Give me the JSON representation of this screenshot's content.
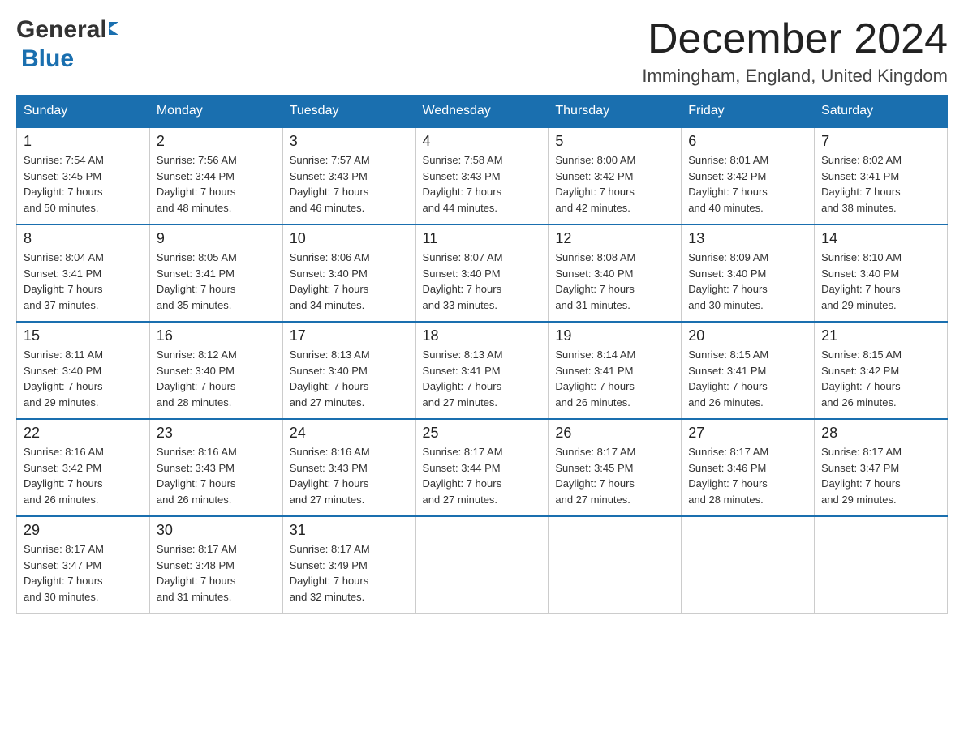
{
  "header": {
    "month_title": "December 2024",
    "location": "Immingham, England, United Kingdom",
    "logo_general": "General",
    "logo_blue": "Blue"
  },
  "days_of_week": [
    "Sunday",
    "Monday",
    "Tuesday",
    "Wednesday",
    "Thursday",
    "Friday",
    "Saturday"
  ],
  "weeks": [
    [
      {
        "day": "1",
        "sunrise": "7:54 AM",
        "sunset": "3:45 PM",
        "daylight": "7 hours and 50 minutes."
      },
      {
        "day": "2",
        "sunrise": "7:56 AM",
        "sunset": "3:44 PM",
        "daylight": "7 hours and 48 minutes."
      },
      {
        "day": "3",
        "sunrise": "7:57 AM",
        "sunset": "3:43 PM",
        "daylight": "7 hours and 46 minutes."
      },
      {
        "day": "4",
        "sunrise": "7:58 AM",
        "sunset": "3:43 PM",
        "daylight": "7 hours and 44 minutes."
      },
      {
        "day": "5",
        "sunrise": "8:00 AM",
        "sunset": "3:42 PM",
        "daylight": "7 hours and 42 minutes."
      },
      {
        "day": "6",
        "sunrise": "8:01 AM",
        "sunset": "3:42 PM",
        "daylight": "7 hours and 40 minutes."
      },
      {
        "day": "7",
        "sunrise": "8:02 AM",
        "sunset": "3:41 PM",
        "daylight": "7 hours and 38 minutes."
      }
    ],
    [
      {
        "day": "8",
        "sunrise": "8:04 AM",
        "sunset": "3:41 PM",
        "daylight": "7 hours and 37 minutes."
      },
      {
        "day": "9",
        "sunrise": "8:05 AM",
        "sunset": "3:41 PM",
        "daylight": "7 hours and 35 minutes."
      },
      {
        "day": "10",
        "sunrise": "8:06 AM",
        "sunset": "3:40 PM",
        "daylight": "7 hours and 34 minutes."
      },
      {
        "day": "11",
        "sunrise": "8:07 AM",
        "sunset": "3:40 PM",
        "daylight": "7 hours and 33 minutes."
      },
      {
        "day": "12",
        "sunrise": "8:08 AM",
        "sunset": "3:40 PM",
        "daylight": "7 hours and 31 minutes."
      },
      {
        "day": "13",
        "sunrise": "8:09 AM",
        "sunset": "3:40 PM",
        "daylight": "7 hours and 30 minutes."
      },
      {
        "day": "14",
        "sunrise": "8:10 AM",
        "sunset": "3:40 PM",
        "daylight": "7 hours and 29 minutes."
      }
    ],
    [
      {
        "day": "15",
        "sunrise": "8:11 AM",
        "sunset": "3:40 PM",
        "daylight": "7 hours and 29 minutes."
      },
      {
        "day": "16",
        "sunrise": "8:12 AM",
        "sunset": "3:40 PM",
        "daylight": "7 hours and 28 minutes."
      },
      {
        "day": "17",
        "sunrise": "8:13 AM",
        "sunset": "3:40 PM",
        "daylight": "7 hours and 27 minutes."
      },
      {
        "day": "18",
        "sunrise": "8:13 AM",
        "sunset": "3:41 PM",
        "daylight": "7 hours and 27 minutes."
      },
      {
        "day": "19",
        "sunrise": "8:14 AM",
        "sunset": "3:41 PM",
        "daylight": "7 hours and 26 minutes."
      },
      {
        "day": "20",
        "sunrise": "8:15 AM",
        "sunset": "3:41 PM",
        "daylight": "7 hours and 26 minutes."
      },
      {
        "day": "21",
        "sunrise": "8:15 AM",
        "sunset": "3:42 PM",
        "daylight": "7 hours and 26 minutes."
      }
    ],
    [
      {
        "day": "22",
        "sunrise": "8:16 AM",
        "sunset": "3:42 PM",
        "daylight": "7 hours and 26 minutes."
      },
      {
        "day": "23",
        "sunrise": "8:16 AM",
        "sunset": "3:43 PM",
        "daylight": "7 hours and 26 minutes."
      },
      {
        "day": "24",
        "sunrise": "8:16 AM",
        "sunset": "3:43 PM",
        "daylight": "7 hours and 27 minutes."
      },
      {
        "day": "25",
        "sunrise": "8:17 AM",
        "sunset": "3:44 PM",
        "daylight": "7 hours and 27 minutes."
      },
      {
        "day": "26",
        "sunrise": "8:17 AM",
        "sunset": "3:45 PM",
        "daylight": "7 hours and 27 minutes."
      },
      {
        "day": "27",
        "sunrise": "8:17 AM",
        "sunset": "3:46 PM",
        "daylight": "7 hours and 28 minutes."
      },
      {
        "day": "28",
        "sunrise": "8:17 AM",
        "sunset": "3:47 PM",
        "daylight": "7 hours and 29 minutes."
      }
    ],
    [
      {
        "day": "29",
        "sunrise": "8:17 AM",
        "sunset": "3:47 PM",
        "daylight": "7 hours and 30 minutes."
      },
      {
        "day": "30",
        "sunrise": "8:17 AM",
        "sunset": "3:48 PM",
        "daylight": "7 hours and 31 minutes."
      },
      {
        "day": "31",
        "sunrise": "8:17 AM",
        "sunset": "3:49 PM",
        "daylight": "7 hours and 32 minutes."
      },
      null,
      null,
      null,
      null
    ]
  ]
}
